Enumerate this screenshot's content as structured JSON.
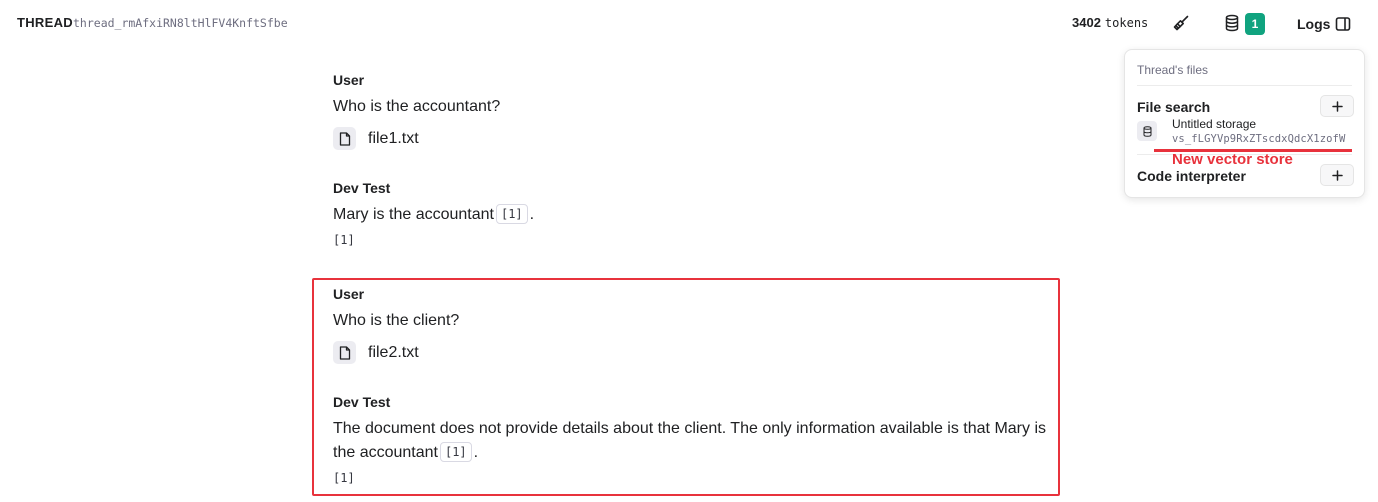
{
  "header": {
    "thread_label": "THREAD",
    "thread_id": "thread_rmAfxiRN8ltHlFV4KnftSfbe",
    "tokens_count": "3402",
    "tokens_unit": "tokens",
    "files_count": "1",
    "logs_label": "Logs"
  },
  "messages": [
    {
      "role": "User",
      "text": "Who is the accountant?",
      "file": "file1.txt"
    },
    {
      "role": "Dev Test",
      "text": "Mary is the accountant",
      "citation": "[1]",
      "trailing": ".",
      "reference": "[1]"
    },
    {
      "role": "User",
      "text": "Who is the client?",
      "file": "file2.txt"
    },
    {
      "role": "Dev Test",
      "text": "The document does not provide details about the client. The only information available is that Mary is the accountant",
      "citation": "[1]",
      "trailing": ".",
      "reference": "[1]"
    }
  ],
  "files_panel": {
    "title": "Thread's files",
    "file_search_label": "File search",
    "storage_name": "Untitled storage",
    "storage_id": "vs_fLGYVp9RxZTscdxQdcX1zofW",
    "code_interpreter_label": "Code interpreter"
  },
  "annotation": {
    "label": "New vector store",
    "color": "#e8323c"
  },
  "colors": {
    "accent_badge": "#10a37f",
    "highlight": "#e8323c"
  }
}
